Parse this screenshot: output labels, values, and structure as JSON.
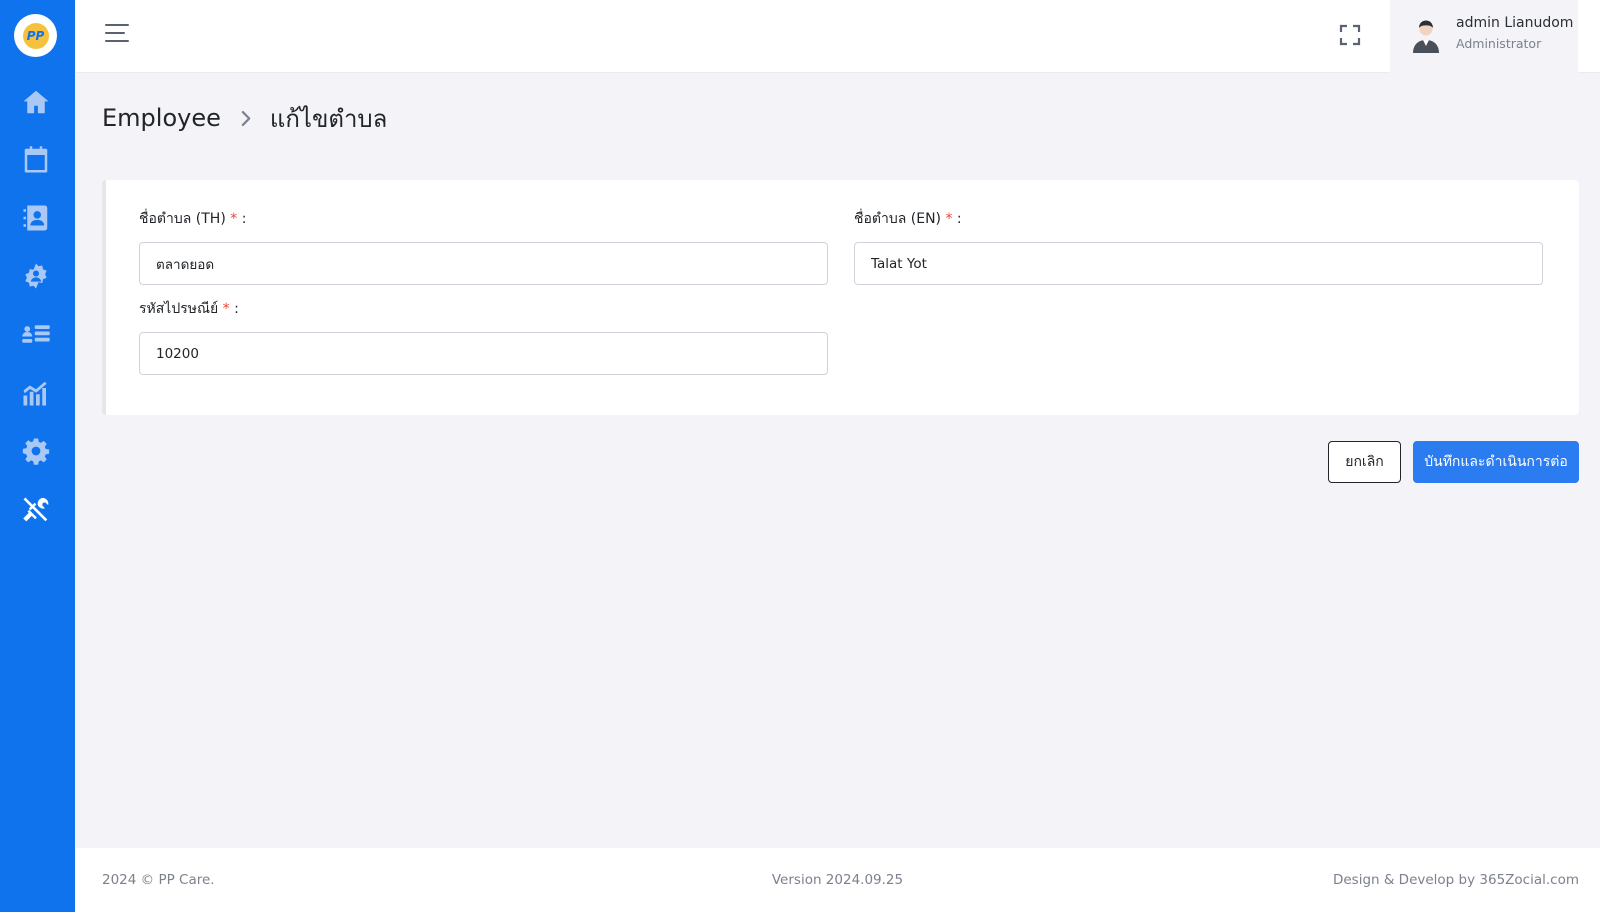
{
  "app": {
    "logo_text": "PP"
  },
  "sidebar": {
    "items": [
      {
        "icon": "home-icon"
      },
      {
        "icon": "calendar-dollar-icon"
      },
      {
        "icon": "contact-book-icon"
      },
      {
        "icon": "team-gear-icon"
      },
      {
        "icon": "list-users-icon"
      },
      {
        "icon": "chart-growth-icon"
      },
      {
        "icon": "gear-icon"
      },
      {
        "icon": "tools-icon",
        "active": true
      }
    ]
  },
  "header": {
    "user_name": "admin Lianudom",
    "user_role": "Administrator"
  },
  "breadcrumb": {
    "parent": "Employee",
    "current": "แก้ไขตำบล"
  },
  "form": {
    "name_th": {
      "label": "ชื่อตำบล (TH)",
      "required": "*",
      "suffix": " :",
      "value": "ตลาดยอด"
    },
    "name_en": {
      "label": "ชื่อตำบล (EN)",
      "required": "*",
      "suffix": " :",
      "value": "Talat Yot"
    },
    "postal": {
      "label": "รหัสไปรษณีย์",
      "required": "*",
      "suffix": " :",
      "value": "10200"
    }
  },
  "actions": {
    "cancel_label": "ยกเลิก",
    "save_label": "บันทึกและดำเนินการต่อ"
  },
  "footer": {
    "copyright": "2024 © PP Care.",
    "version": "Version 2024.09.25",
    "credit": "Design & Develop by 365Zocial.com"
  }
}
